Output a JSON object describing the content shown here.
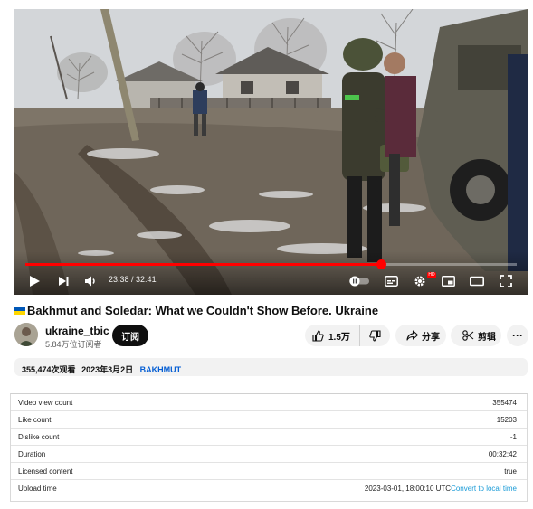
{
  "player": {
    "current_time": "23:38",
    "duration": "32:41",
    "time_separator": " / ",
    "progress_fraction": 0.723,
    "hd_badge": "HD",
    "colors": {
      "progress": "#ff0000"
    },
    "controls": [
      "play-icon",
      "next-icon",
      "volume-icon",
      "autoplay-toggle",
      "subtitles-icon",
      "settings-icon",
      "miniplayer-icon",
      "theater-icon",
      "fullscreen-icon"
    ]
  },
  "video": {
    "title": "Bakhmut and Soledar: What we Couldn't Show Before. Ukraine",
    "flag_colors": [
      "#0057b7",
      "#ffd700"
    ]
  },
  "channel": {
    "name": "ukraine_tbic",
    "subscribers": "5.84万位订阅者",
    "subscribe_label": "订阅"
  },
  "actions": {
    "like_count": "1.5万",
    "share_label": "分享",
    "clip_label": "剪辑",
    "more_label": "···"
  },
  "description": {
    "views": "355,474次观看",
    "date": "2023年3月2日",
    "tag": "BAKHMUT"
  },
  "stats": [
    {
      "label": "Video view count",
      "value": "355474"
    },
    {
      "label": "Like count",
      "value": "15203"
    },
    {
      "label": "Dislike count",
      "value": "-1"
    },
    {
      "label": "Duration",
      "value": "00:32:42"
    },
    {
      "label": "Licensed content",
      "value": "true"
    },
    {
      "label": "Upload time",
      "value": "2023-03-01, 18:00:10 UTC",
      "link": "Convert to local time"
    }
  ]
}
